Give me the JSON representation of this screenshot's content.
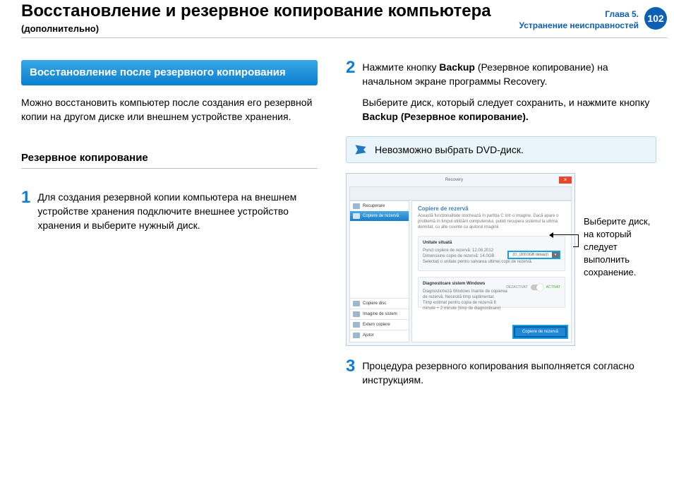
{
  "header": {
    "title": "Восстановление и резервное копирование компьютера",
    "subtitle": "(дополнительно)",
    "chapter_line1": "Глава 5.",
    "chapter_line2": "Устранение неисправностей",
    "page_number": "102"
  },
  "left": {
    "banner": "Восстановление после резервного копирования",
    "intro": "Можно восстановить компьютер после создания его резервной копии на другом диске или внешнем устройстве хранения.",
    "subsection": "Резервное копирование",
    "step1_num": "1",
    "step1_text": "Для создания резервной копии компьютера на внешнем устройстве хранения подключите внешнее устройство хранения и выберите нужный диск."
  },
  "right": {
    "step2_num": "2",
    "step2_text_a": "Нажмите кнопку ",
    "step2_text_b": "Backup",
    "step2_text_c": " (Резервное копирование) на начальном экране программы Recovery.",
    "step2_text_d": "Выберите диск, который следует сохранить, и нажмите кнопку ",
    "step2_text_e": "Backup (Резервное копирование).",
    "info_text": "Невозможно выбрать DVD-диск.",
    "callout": "Выберите диск, на который следует выполнить сохранение.",
    "step3_num": "3",
    "step3_text": "Процедура резервного копирования выполняется согласно инструкциям."
  },
  "screenshot": {
    "app_title": "Recovery",
    "close_x": "×",
    "side_item1": "Recuperare",
    "side_item2": "Copiere de rezervă",
    "side_bottom1": "Copiere disc",
    "side_bottom2": "Imagine de sistem",
    "side_bottom3": "Extern copiere",
    "side_bottom4": "Ajutor",
    "main_title": "Copiere de rezervă",
    "main_desc": "Această funcționalitate stochează în partiția C într-o imagine. Dacă apare o problemă în timpul utilizării computerului, puteți recupera sistemul la ultima dennitat, cu alte cuvinte cu ajutorul imaginii.",
    "panel1_title": "Unitate situată",
    "panel1_line1": "Punct copiere de rezervă: 12.08.2012",
    "panel1_line2": "Dimensiune copie de rezervă: 14.0GB",
    "panel1_line3": "Selectați o unitate pentru salvarea ultimei copii de rezervă.",
    "drive_label": "(D:, (200.0GB rămași))",
    "panel2_title": "Diagnosticare sistem Windows",
    "panel2_line1": "Diagnosticheză Windows înainte de copierea de rezervă. Necesită timp suplimentar.",
    "panel2_line2": "Timp estimat pentru copia de rezervă 8 minute + 2 minute (timp de diagnosticare)",
    "toggle_off": "DEZACTIVAT",
    "toggle_on": "ACTIVAT",
    "backup_button": "Copiere de rezervă"
  }
}
